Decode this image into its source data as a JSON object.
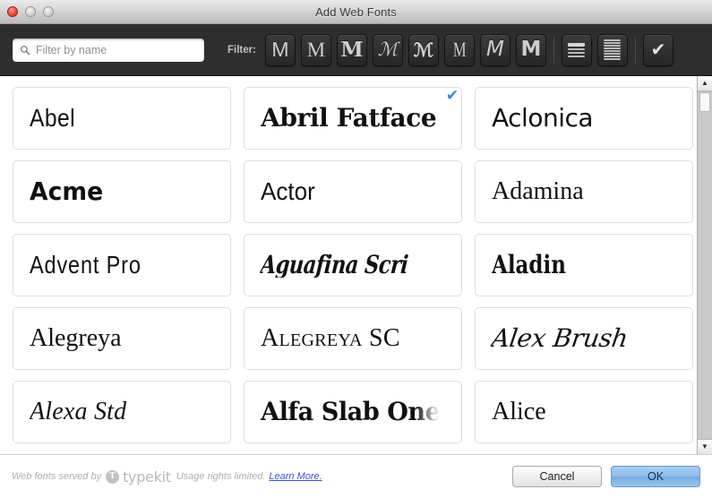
{
  "window": {
    "title": "Add Web Fonts",
    "traffic_lights": [
      "close-button",
      "minimize-button",
      "maximize-button"
    ]
  },
  "toolbar": {
    "search": {
      "icon": "search-icon",
      "value": "",
      "placeholder": "Filter by name"
    },
    "filter_label": "Filter:",
    "filter_buttons": [
      {
        "name": "filter-sans-serif",
        "glyph": "M",
        "style": "g-sans",
        "icon": "letter-m-sans-icon"
      },
      {
        "name": "filter-serif",
        "glyph": "M",
        "style": "g-serif",
        "icon": "letter-m-serif-icon"
      },
      {
        "name": "filter-slab-serif",
        "glyph": "M",
        "style": "g-slab",
        "icon": "letter-m-slab-icon"
      },
      {
        "name": "filter-script",
        "glyph": "ℳ",
        "style": "g-script",
        "icon": "letter-m-script-icon"
      },
      {
        "name": "filter-blackletter",
        "glyph": "ℳ",
        "style": "g-black",
        "icon": "letter-m-blackletter-icon"
      },
      {
        "name": "filter-condensed",
        "glyph": "M",
        "style": "g-cond",
        "icon": "letter-m-condensed-icon"
      },
      {
        "name": "filter-handwriting",
        "glyph": "M",
        "style": "g-hand",
        "icon": "letter-m-handwriting-icon"
      },
      {
        "name": "filter-display",
        "glyph": "M",
        "style": "g-heavy",
        "icon": "letter-m-display-icon"
      }
    ],
    "paragraph_buttons": [
      {
        "name": "filter-headline-text",
        "icon": "headline-lines-icon"
      },
      {
        "name": "filter-body-text",
        "icon": "paragraph-lines-icon"
      }
    ],
    "selected_button": {
      "name": "show-selected-button",
      "icon": "checkmark-icon",
      "glyph": "✔"
    }
  },
  "fonts": [
    {
      "name": "Abel",
      "style": "s-abel",
      "selected": false
    },
    {
      "name": "Abril Fatface",
      "style": "s-abril",
      "selected": true
    },
    {
      "name": "Aclonica",
      "style": "s-aclonica",
      "selected": false
    },
    {
      "name": "Acme",
      "style": "s-acme",
      "selected": false
    },
    {
      "name": "Actor",
      "style": "s-actor",
      "selected": false
    },
    {
      "name": "Adamina",
      "style": "s-adamina",
      "selected": false
    },
    {
      "name": "Advent Pro",
      "style": "s-advent",
      "selected": false
    },
    {
      "name": "Aguafina Script",
      "style": "s-aguafina",
      "selected": false
    },
    {
      "name": "Aladin",
      "style": "s-aladin",
      "selected": false
    },
    {
      "name": "Alegreya",
      "style": "s-alegreya",
      "selected": false
    },
    {
      "name": "Alegreya SC",
      "style": "s-alegreyasc",
      "selected": false
    },
    {
      "name": "Alex Brush",
      "style": "s-alexbrush",
      "selected": false
    },
    {
      "name": "Alexa Std",
      "style": "s-alexastd",
      "selected": false
    },
    {
      "name": "Alfa Slab One",
      "style": "s-alfaslab",
      "selected": false
    },
    {
      "name": "Alice",
      "style": "s-alice",
      "selected": false
    }
  ],
  "scrollbar": {
    "up_arrow": "▲",
    "down_arrow": "▼"
  },
  "footer": {
    "credit_prefix": "Web fonts served by",
    "brand": "typekit",
    "brand_mark": "T",
    "usage_text": "Usage rights limited.",
    "learn_more": "Learn More.",
    "cancel_label": "Cancel",
    "ok_label": "OK"
  },
  "colors": {
    "toolbar_bg": "#2e2e2e",
    "accent_check": "#2f87e8",
    "ok_button": "#8fbde9",
    "link": "#3a52d8"
  }
}
